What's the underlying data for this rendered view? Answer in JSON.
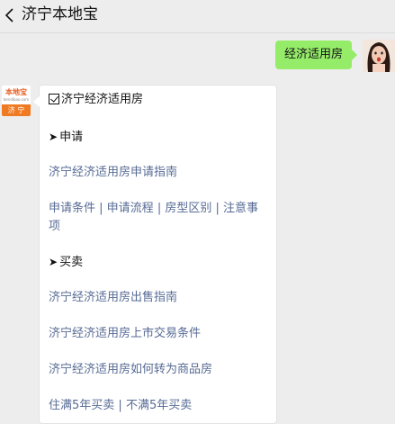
{
  "header": {
    "title": "济宁本地宝"
  },
  "user_message": {
    "text": "经济适用房"
  },
  "bot_logo": {
    "top": "本地宝",
    "mid": "bendibao.com",
    "bottom": "济 宁"
  },
  "reply": {
    "title": "济宁经济适用房",
    "section1": "申请",
    "link1": "济宁经济适用房申请指南",
    "links_row": [
      "申请条件",
      "申请流程",
      "房型区别",
      "注意事"
    ],
    "links_row_wrap": "项",
    "section2": "买卖",
    "link2": "济宁经济适用房出售指南",
    "link3": "济宁经济适用房上市交易条件",
    "link4": "济宁经济适用房如何转为商品房",
    "bottom_row": [
      "住满5年买卖",
      "不满5年买卖"
    ]
  },
  "colors": {
    "accent_link": "#576b95",
    "user_bubble": "#95ec69",
    "logo_orange": "#f07a22"
  }
}
